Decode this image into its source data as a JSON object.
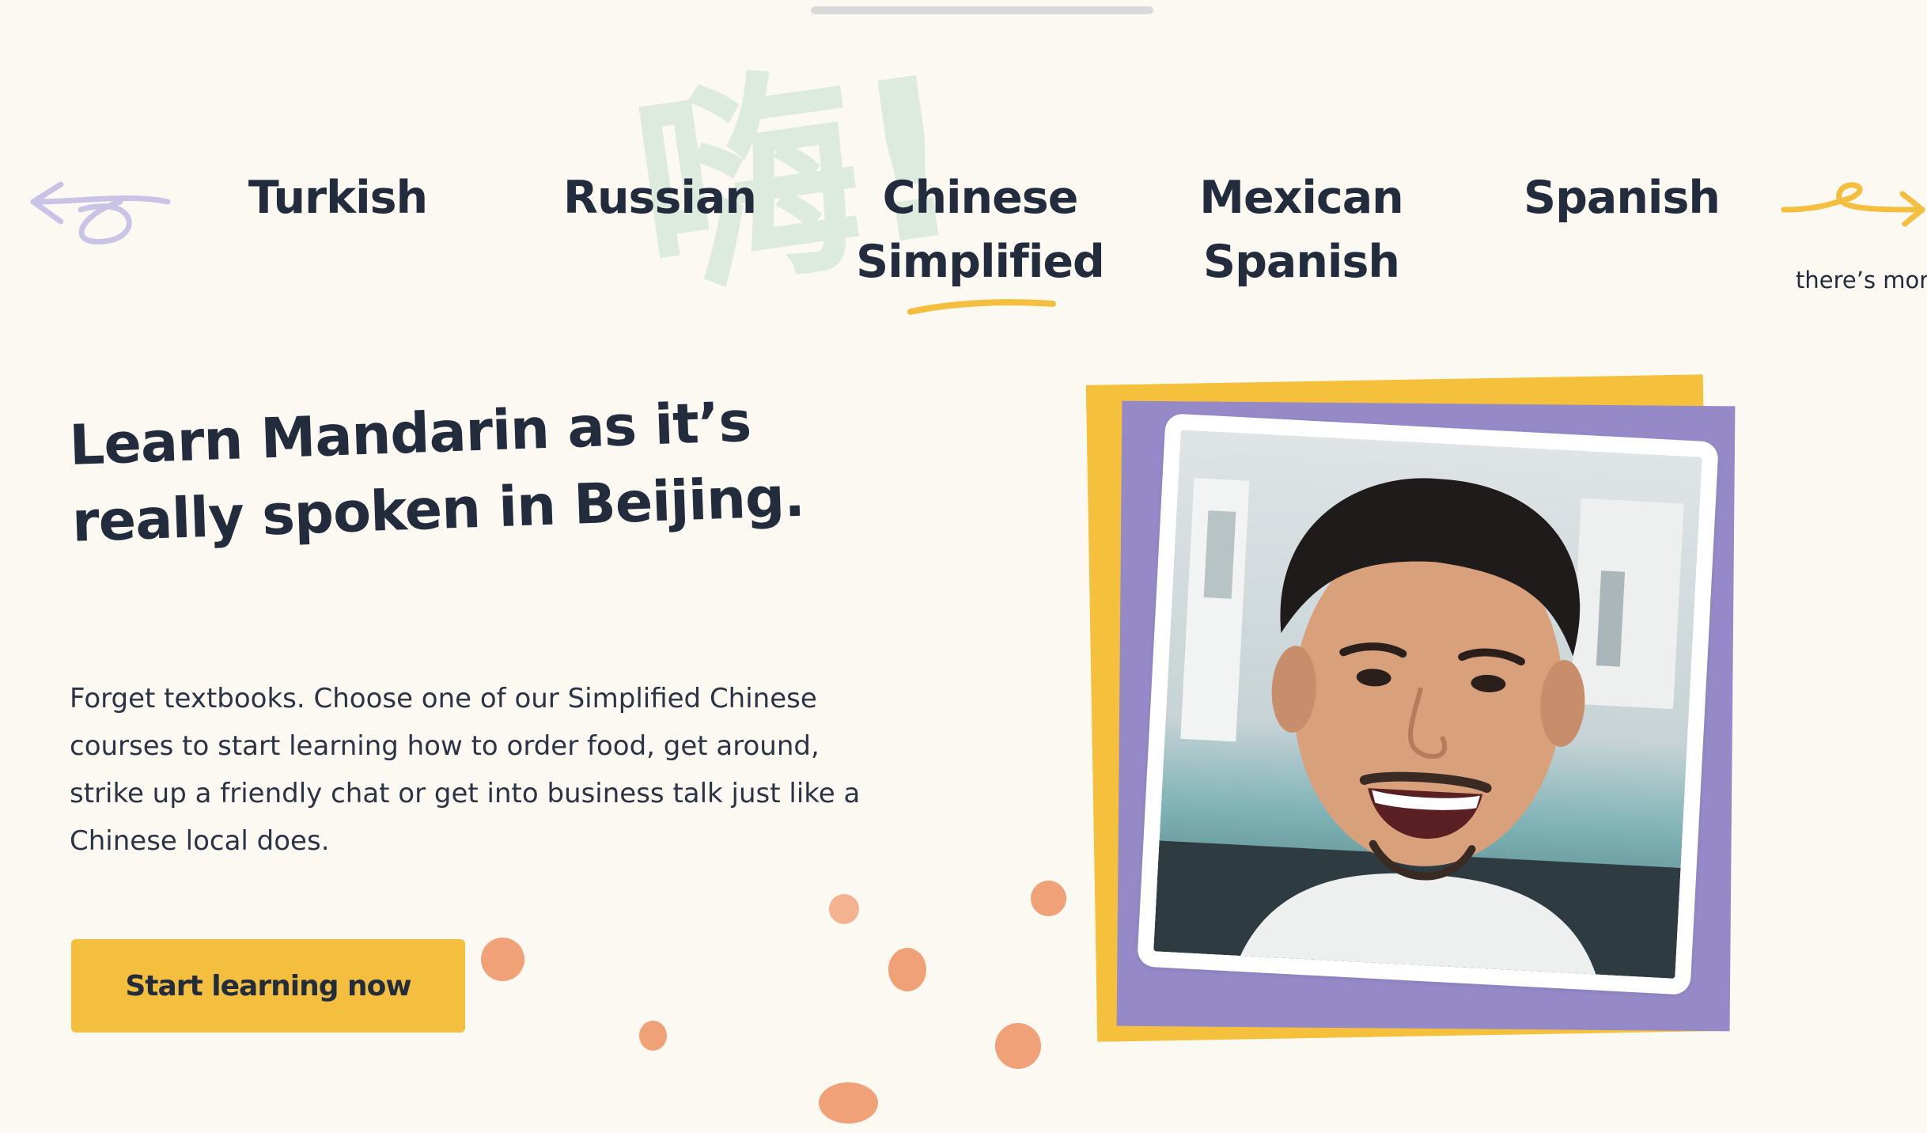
{
  "background_glyph": "嗨!",
  "languages": [
    {
      "label_line1": "Turkish",
      "label_line2": ""
    },
    {
      "label_line1": "Russian",
      "label_line2": ""
    },
    {
      "label_line1": "Chinese",
      "label_line2": "Simplified"
    },
    {
      "label_line1": "Mexican",
      "label_line2": "Spanish"
    },
    {
      "label_line1": "Spanish",
      "label_line2": ""
    }
  ],
  "more_text": "there’s more",
  "hero": {
    "headline_line1": "Learn Mandarin as it’s",
    "headline_line2": "really spoken in Beijing.",
    "body_line1": "Forget textbooks. Choose one of our Simplified Chinese",
    "body_line2": "courses to start learning how to order food, get around,",
    "body_line3": "strike up a friendly chat or get into business talk just like a",
    "body_line4": "Chinese local does.",
    "cta_label": "Start learning now"
  },
  "colors": {
    "background": "#fcf9f3",
    "text": "#232c3d",
    "accent_yellow": "#f4bf3e",
    "accent_purple": "#9589c8",
    "splash_orange": "#f0a178",
    "glyph_green": "#dcebdd"
  },
  "icons": {
    "left_arrow": "arrow-left-icon",
    "right_arrow": "arrow-right-icon"
  }
}
